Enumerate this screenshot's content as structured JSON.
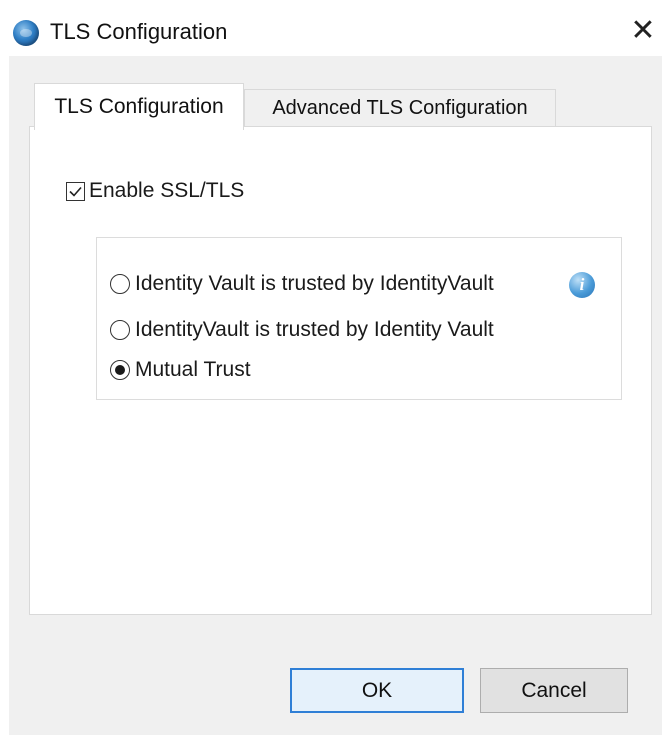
{
  "window": {
    "title": "TLS Configuration",
    "close_glyph": "✕",
    "app_icon": "globe-icon"
  },
  "tabs": [
    {
      "label": "TLS Configuration",
      "active": true
    },
    {
      "label": "Advanced TLS Configuration",
      "active": false
    }
  ],
  "panel": {
    "enable_ssl": {
      "label": "Enable SSL/TLS",
      "checked": true
    },
    "trust_options": [
      {
        "label": "Identity Vault is trusted by IdentityVault",
        "selected": false,
        "info_icon": "info-icon"
      },
      {
        "label": "IdentityVault is trusted by Identity Vault",
        "selected": false
      },
      {
        "label": "Mutual Trust",
        "selected": true
      }
    ]
  },
  "buttons": {
    "ok_label": "OK",
    "cancel_label": "Cancel"
  },
  "colors": {
    "accent": "#2f7fd6",
    "dialog_bg": "#f0f0f0"
  }
}
